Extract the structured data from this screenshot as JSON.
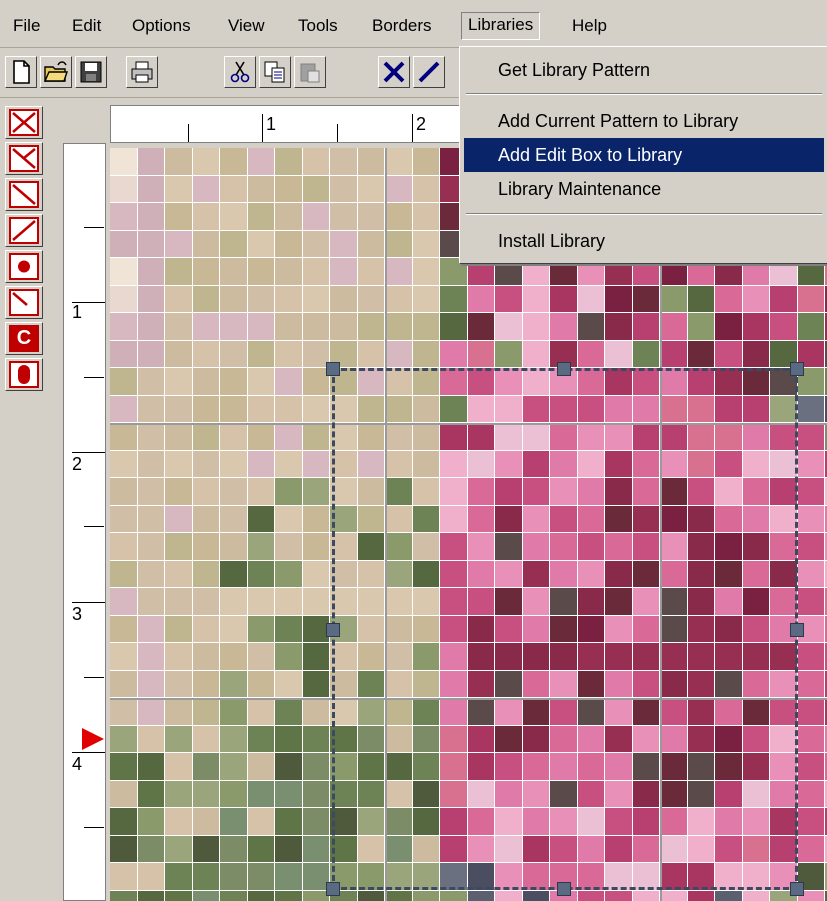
{
  "menubar": {
    "items": [
      "File",
      "Edit",
      "Options",
      "View",
      "Tools",
      "Borders",
      "Libraries",
      "Help"
    ]
  },
  "toolbar": {
    "buttons": [
      "new-file-icon",
      "open-folder-icon",
      "save-disk-icon",
      "print-icon",
      "cut-scissors-icon",
      "copy-icon",
      "paste-icon",
      "full-cross-stitch-icon",
      "half-stitch-icon"
    ]
  },
  "palette": {
    "tools": [
      "full-cross-icon",
      "three-quarter-cross-icon",
      "half-stitch-back-icon",
      "half-stitch-forward-icon",
      "french-knot-icon",
      "quarter-stitch-icon",
      "text-c-icon",
      "bead-icon"
    ],
    "text_c_label": "C"
  },
  "libraries_menu": {
    "items": [
      {
        "label": "Get Library Pattern",
        "highlighted": false
      },
      {
        "label": "Add Current Pattern to Library",
        "highlighted": false
      },
      {
        "label": "Add Edit Box to Library",
        "highlighted": true
      },
      {
        "label": "Library Maintenance",
        "highlighted": false
      },
      {
        "label": "Install Library",
        "highlighted": false
      }
    ]
  },
  "hruler": {
    "labels": [
      "1",
      "2"
    ]
  },
  "vruler": {
    "labels": [
      "1",
      "2",
      "3",
      "4"
    ]
  },
  "colors": {
    "menu_highlight": "#0a246a",
    "stitch_red": "#c00000",
    "marker": "#e00000"
  }
}
